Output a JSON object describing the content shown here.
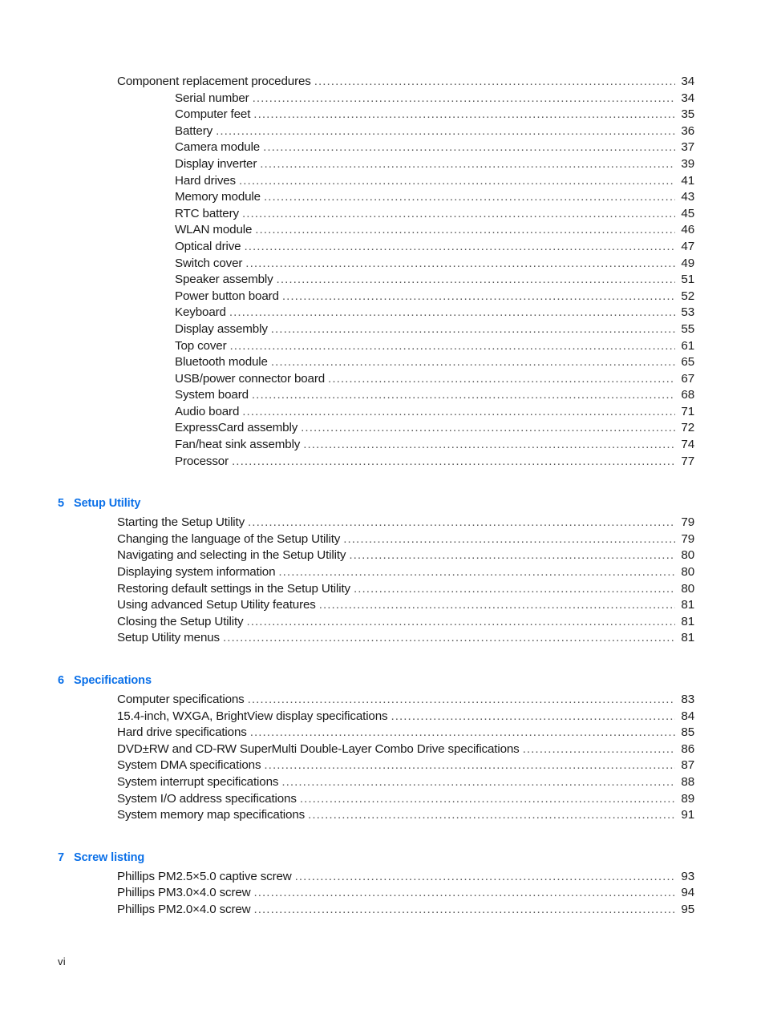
{
  "page": {
    "folio": "vi",
    "accent_color": "#0B70E8",
    "text_color": "#1a1a1a",
    "leader_char": "."
  },
  "sections": [
    {
      "heading": null,
      "entries": [
        {
          "label": "Component replacement procedures",
          "page": "34",
          "level": 1
        },
        {
          "label": "Serial number",
          "page": "34",
          "level": 2
        },
        {
          "label": "Computer feet",
          "page": "35",
          "level": 2
        },
        {
          "label": "Battery",
          "page": "36",
          "level": 2
        },
        {
          "label": "Camera module",
          "page": "37",
          "level": 2
        },
        {
          "label": "Display inverter",
          "page": "39",
          "level": 2
        },
        {
          "label": "Hard drives",
          "page": "41",
          "level": 2
        },
        {
          "label": "Memory module",
          "page": "43",
          "level": 2
        },
        {
          "label": "RTC battery",
          "page": "45",
          "level": 2
        },
        {
          "label": "WLAN module",
          "page": "46",
          "level": 2
        },
        {
          "label": "Optical drive",
          "page": "47",
          "level": 2
        },
        {
          "label": "Switch cover",
          "page": "49",
          "level": 2
        },
        {
          "label": "Speaker assembly",
          "page": "51",
          "level": 2
        },
        {
          "label": "Power button board",
          "page": "52",
          "level": 2
        },
        {
          "label": "Keyboard",
          "page": "53",
          "level": 2
        },
        {
          "label": "Display assembly",
          "page": "55",
          "level": 2
        },
        {
          "label": "Top cover",
          "page": "61",
          "level": 2
        },
        {
          "label": "Bluetooth module",
          "page": "65",
          "level": 2
        },
        {
          "label": "USB/power connector board",
          "page": "67",
          "level": 2
        },
        {
          "label": "System board",
          "page": "68",
          "level": 2
        },
        {
          "label": "Audio board",
          "page": "71",
          "level": 2
        },
        {
          "label": "ExpressCard assembly",
          "page": "72",
          "level": 2
        },
        {
          "label": "Fan/heat sink assembly",
          "page": "74",
          "level": 2
        },
        {
          "label": "Processor",
          "page": "77",
          "level": 2
        }
      ]
    },
    {
      "heading": {
        "number": "5",
        "title": "Setup Utility"
      },
      "entries": [
        {
          "label": "Starting the Setup Utility",
          "page": "79",
          "level": 1
        },
        {
          "label": "Changing the language of the Setup Utility",
          "page": "79",
          "level": 1
        },
        {
          "label": "Navigating and selecting in the Setup Utility",
          "page": "80",
          "level": 1
        },
        {
          "label": "Displaying system information",
          "page": "80",
          "level": 1
        },
        {
          "label": "Restoring default settings in the Setup Utility",
          "page": "80",
          "level": 1
        },
        {
          "label": "Using advanced Setup Utility features",
          "page": "81",
          "level": 1
        },
        {
          "label": "Closing the Setup Utility",
          "page": "81",
          "level": 1
        },
        {
          "label": "Setup Utility menus",
          "page": "81",
          "level": 1
        }
      ]
    },
    {
      "heading": {
        "number": "6",
        "title": "Specifications"
      },
      "entries": [
        {
          "label": "Computer specifications",
          "page": "83",
          "level": 1
        },
        {
          "label": "15.4-inch, WXGA, BrightView display specifications",
          "page": "84",
          "level": 1
        },
        {
          "label": "Hard drive specifications",
          "page": "85",
          "level": 1
        },
        {
          "label": "DVD±RW and CD-RW SuperMulti Double-Layer Combo Drive specifications",
          "page": "86",
          "level": 1
        },
        {
          "label": "System DMA specifications",
          "page": "87",
          "level": 1
        },
        {
          "label": "System interrupt specifications",
          "page": "88",
          "level": 1
        },
        {
          "label": "System I/O address specifications",
          "page": "89",
          "level": 1
        },
        {
          "label": "System memory map specifications",
          "page": "91",
          "level": 1
        }
      ]
    },
    {
      "heading": {
        "number": "7",
        "title": "Screw listing"
      },
      "entries": [
        {
          "label": "Phillips PM2.5×5.0 captive screw",
          "page": "93",
          "level": 1
        },
        {
          "label": "Phillips PM3.0×4.0 screw",
          "page": "94",
          "level": 1
        },
        {
          "label": "Phillips PM2.0×4.0 screw",
          "page": "95",
          "level": 1
        }
      ]
    }
  ]
}
